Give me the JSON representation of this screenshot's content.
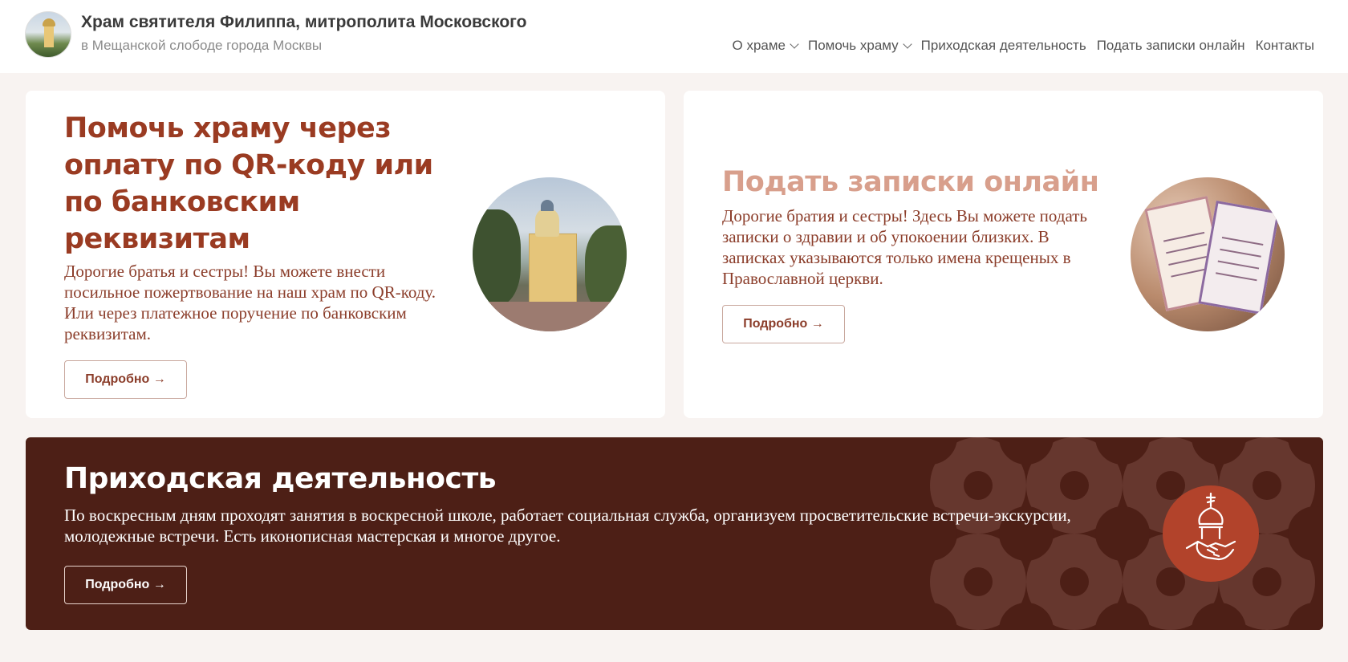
{
  "header": {
    "title": "Храм святителя Филиппа, митрополита Московского",
    "subtitle": "в Мещанской слободе города Москвы",
    "logo_icon": "church-icon"
  },
  "nav": {
    "items": [
      {
        "label": "О храме",
        "has_dropdown": true
      },
      {
        "label": "Помочь храму",
        "has_dropdown": true
      },
      {
        "label": "Приходская деятельность",
        "has_dropdown": false
      },
      {
        "label": "Подать записки онлайн",
        "has_dropdown": false
      },
      {
        "label": "Контакты",
        "has_dropdown": false
      }
    ]
  },
  "cards": [
    {
      "title": "Помочь храму через оплату по QR-коду или по банковским реквизитам",
      "text": "Дорогие братья и сестры! Вы можете внести посильное пожертвование на наш храм по QR-коду. Или через платежное поручение по банковским реквизитам.",
      "button": "Подробно →"
    },
    {
      "title": "Подать записки онлайн",
      "text": "Дорогие братия и сестры! Здесь Вы можете подать записки о здравии и об упокоении близких. В записках указываются только имена крещеных в Православной церкви.",
      "button": "Подробно →"
    }
  ],
  "banner": {
    "title": "Приходская деятельность",
    "text": "По воскресным дням проходят занятия в воскресной школе, работает социальная служба, организуем просветительские встречи-экскурсии, молодежные встречи. Есть иконописная мастерская и многое другое.",
    "button": "Подробно →",
    "emblem_icon": "church-handshake-icon"
  },
  "colors": {
    "accent": "#9a3b22",
    "accent_light": "#d89f8c",
    "banner_bg": "#4d1f16",
    "emblem_bg": "#b2432b",
    "page_bg": "#f8f3f1"
  }
}
